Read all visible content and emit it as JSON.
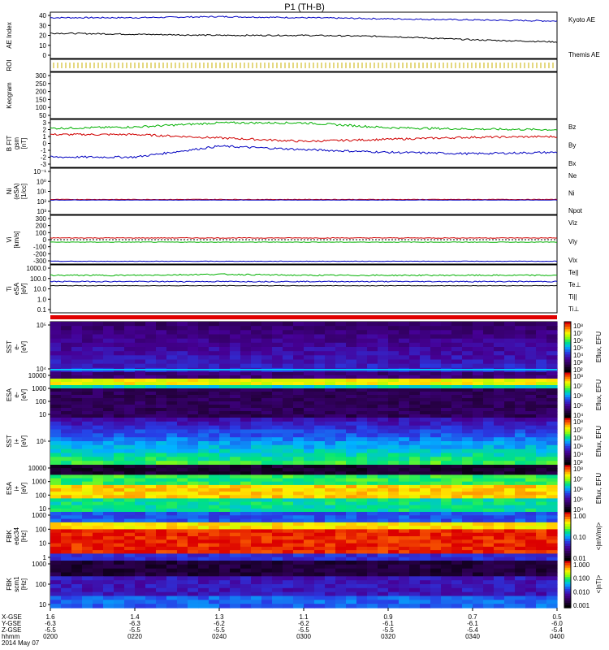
{
  "title": "P1 (TH-B)",
  "panels": [
    {
      "id": "ae",
      "ylabel": [
        "AE Index"
      ],
      "ticks": [
        "40",
        "30",
        "20",
        "10",
        "0"
      ],
      "legend": [
        {
          "text": "Kyoto AE",
          "color": "#0000c0"
        },
        {
          "text": "Themis AE",
          "color": "#000000"
        }
      ]
    },
    {
      "id": "roi",
      "ylabel": [
        "ROI"
      ],
      "ticks": [],
      "legend": []
    },
    {
      "id": "keo",
      "ylabel": [
        "Keogram"
      ],
      "ticks": [
        "300",
        "250",
        "200",
        "150",
        "100",
        "50"
      ],
      "legend": []
    },
    {
      "id": "bfield",
      "ylabel": [
        "B FIT",
        "gsm",
        "[nT]"
      ],
      "ticks": [
        "3",
        "2",
        "1",
        "0",
        "-1",
        "-2",
        "-3"
      ],
      "legend": [
        {
          "text": "Bz",
          "color": "#d00000"
        },
        {
          "text": "By",
          "color": "#00b000"
        },
        {
          "text": "Bx",
          "color": "#0000c0"
        }
      ]
    },
    {
      "id": "ni",
      "ylabel": [
        "Ni",
        "(eSA)",
        "[1/cc]"
      ],
      "ticks": [
        "10⁻¹",
        "10⁰",
        "10¹",
        "10²",
        "10³"
      ],
      "legend": [
        {
          "text": "Ne",
          "color": "#d00000"
        },
        {
          "text": "Ni",
          "color": "#000000"
        },
        {
          "text": "Npot",
          "color": "#0000c0"
        }
      ]
    },
    {
      "id": "vi",
      "ylabel": [
        "Vi",
        "[km/s]"
      ],
      "ticks": [
        "300",
        "200",
        "100",
        "0",
        "-100",
        "-200",
        "-300"
      ],
      "legend": [
        {
          "text": "Viz",
          "color": "#d00000"
        },
        {
          "text": "Viy",
          "color": "#00b000"
        },
        {
          "text": "Vix",
          "color": "#0000c0"
        }
      ]
    },
    {
      "id": "ti",
      "ylabel": [
        "Ti",
        "eSA",
        "[eV]"
      ],
      "ticks": [
        "1000.0",
        "100.0",
        "10.0",
        "1.0",
        "0.1"
      ],
      "legend": [
        {
          "text": "Te||",
          "color": "#000000"
        },
        {
          "text": "Te⊥",
          "color": "#d00000"
        },
        {
          "text": "Ti||",
          "color": "#00b000"
        },
        {
          "text": "Ti⊥",
          "color": "#0000c0"
        }
      ]
    },
    {
      "id": "sste",
      "ylabel": [
        "SST",
        "e-",
        "[eV]"
      ],
      "ticks": [
        "10⁵",
        "10⁴"
      ],
      "legend": []
    },
    {
      "id": "esae",
      "ylabel": [
        "ESA",
        "e-",
        "[eV]"
      ],
      "ticks": [
        "10000",
        "1000",
        "100",
        "10"
      ],
      "legend": []
    },
    {
      "id": "ssti",
      "ylabel": [
        "SST",
        "i+",
        "[eV]"
      ],
      "ticks": [
        "10⁵"
      ],
      "legend": []
    },
    {
      "id": "esai",
      "ylabel": [
        "ESA",
        "i+",
        "[eV]"
      ],
      "ticks": [
        "10000",
        "1000",
        "100",
        "10"
      ],
      "legend": []
    },
    {
      "id": "fbk1",
      "ylabel": [
        "FBK",
        "edc34",
        "[Hz]"
      ],
      "ticks": [
        "1000",
        "100",
        "10",
        "1"
      ],
      "legend": []
    },
    {
      "id": "fbk2",
      "ylabel": [
        "FBK",
        "scm1",
        "[Hz]"
      ],
      "ticks": [
        "1000",
        "100",
        "10"
      ],
      "legend": []
    }
  ],
  "colorbars": [
    {
      "label": "Eflux, EFU",
      "ticks": [
        "10⁸",
        "10⁷",
        "10⁶",
        "10⁵",
        "10⁴",
        "10³",
        "10²"
      ]
    },
    {
      "label": "Eflux, EFU",
      "ticks": [
        "10⁸",
        "10⁷",
        "10⁶",
        "10⁵",
        "10⁴"
      ]
    },
    {
      "label": "Eflux, EFU",
      "ticks": [
        "10⁸",
        "10⁷",
        "10⁶",
        "10⁵",
        "10⁴",
        "10³"
      ]
    },
    {
      "label": "Eflux, EFU",
      "ticks": [
        "10⁸",
        "10⁷",
        "10⁶",
        "10⁵",
        "10⁴"
      ]
    },
    {
      "label": "<|mV/m|>",
      "ticks": [
        "1.00",
        "0.10",
        "0.01"
      ]
    },
    {
      "label": "<|nT|>",
      "ticks": [
        "1.000",
        "0.100",
        "0.010",
        "0.001"
      ]
    }
  ],
  "footer": {
    "row_labels": [
      "X-GSE",
      "Y-GSE",
      "Z-GSE",
      "hhmm",
      "2014 May 07"
    ],
    "columns": [
      {
        "x": "1.6",
        "y": "-6.3",
        "z": "-5.5",
        "t": "0200"
      },
      {
        "x": "1.4",
        "y": "-6.3",
        "z": "-5.5",
        "t": "0220"
      },
      {
        "x": "1.3",
        "y": "-6.2",
        "z": "-5.5",
        "t": "0240"
      },
      {
        "x": "1.1",
        "y": "-6.2",
        "z": "-5.5",
        "t": "0300"
      },
      {
        "x": "0.9",
        "y": "-6.1",
        "z": "-5.5",
        "t": "0320"
      },
      {
        "x": "0.7",
        "y": "-6.1",
        "z": "-5.4",
        "t": "0340"
      },
      {
        "x": "0.5",
        "y": "-6.0",
        "z": "-5.4",
        "t": "0400"
      }
    ]
  },
  "chart_data": {
    "type": "line",
    "title": "P1 (TH-B)",
    "x": [
      "0200",
      "0220",
      "0240",
      "0300",
      "0320",
      "0340",
      "0400"
    ],
    "series": [
      {
        "name": "Kyoto AE",
        "values": [
          37,
          37,
          38,
          37,
          36,
          35,
          34
        ]
      },
      {
        "name": "Themis AE",
        "values": [
          23,
          22,
          21,
          21,
          20,
          17,
          15
        ]
      },
      {
        "name": "Bz",
        "values": [
          1.3,
          1.3,
          0.8,
          0.3,
          0.6,
          0.9,
          1.0
        ]
      },
      {
        "name": "By",
        "values": [
          2.2,
          2.4,
          3.0,
          3.0,
          2.3,
          2.1,
          2.0
        ]
      },
      {
        "name": "Bx",
        "values": [
          -2.0,
          -2.0,
          -0.4,
          -0.9,
          -1.3,
          -1.5,
          -1.3
        ]
      }
    ]
  }
}
